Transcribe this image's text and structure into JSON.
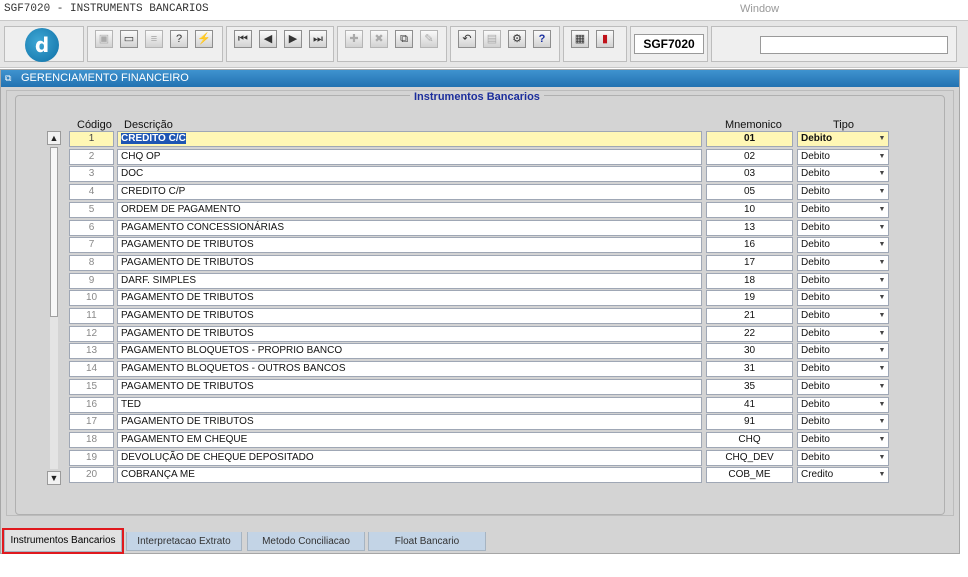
{
  "app": {
    "title": "SGF7020 - INSTRUMENTS BANCARIOS",
    "menu_window": "Window"
  },
  "toolbar": {
    "form_code": "SGF7020",
    "input_value": "",
    "icons": [
      "logo-d-icon",
      "save-icon",
      "window-icon",
      "print-icon",
      "help-query-icon",
      "execute-query-icon",
      "first-record-icon",
      "previous-record-icon",
      "next-record-icon",
      "last-record-icon",
      "insert-record-icon",
      "delete-record-icon",
      "duplicate-icon",
      "clear-icon",
      "undo-icon",
      "clipboard-icon",
      "tools-icon",
      "help-icon",
      "calculator-icon",
      "exit-icon"
    ]
  },
  "window": {
    "title": "GERENCIAMENTO FINANCEIRO",
    "section_title": "Instrumentos Bancarios"
  },
  "table": {
    "headers": {
      "code": "Código",
      "description": "Descrição",
      "mnemonic": "Mnemonico",
      "type": "Tipo"
    },
    "rows": [
      {
        "code": "1",
        "description": "CREDITO C/C",
        "mnemonic": "01",
        "type": "Debito"
      },
      {
        "code": "2",
        "description": "CHQ OP",
        "mnemonic": "02",
        "type": "Debito"
      },
      {
        "code": "3",
        "description": "DOC",
        "mnemonic": "03",
        "type": "Debito"
      },
      {
        "code": "4",
        "description": "CREDITO C/P",
        "mnemonic": "05",
        "type": "Debito"
      },
      {
        "code": "5",
        "description": "ORDEM DE PAGAMENTO",
        "mnemonic": "10",
        "type": "Debito"
      },
      {
        "code": "6",
        "description": "PAGAMENTO CONCESSIONÁRIAS",
        "mnemonic": "13",
        "type": "Debito"
      },
      {
        "code": "7",
        "description": "PAGAMENTO DE TRIBUTOS",
        "mnemonic": "16",
        "type": "Debito"
      },
      {
        "code": "8",
        "description": "PAGAMENTO DE TRIBUTOS",
        "mnemonic": "17",
        "type": "Debito"
      },
      {
        "code": "9",
        "description": "DARF. SIMPLES",
        "mnemonic": "18",
        "type": "Debito"
      },
      {
        "code": "10",
        "description": "PAGAMENTO DE TRIBUTOS",
        "mnemonic": "19",
        "type": "Debito"
      },
      {
        "code": "11",
        "description": "PAGAMENTO DE TRIBUTOS",
        "mnemonic": "21",
        "type": "Debito"
      },
      {
        "code": "12",
        "description": "PAGAMENTO DE TRIBUTOS",
        "mnemonic": "22",
        "type": "Debito"
      },
      {
        "code": "13",
        "description": "PAGAMENTO BLOQUETOS - PROPRIO BANCO",
        "mnemonic": "30",
        "type": "Debito"
      },
      {
        "code": "14",
        "description": "PAGAMENTO BLOQUETOS - OUTROS BANCOS",
        "mnemonic": "31",
        "type": "Debito"
      },
      {
        "code": "15",
        "description": "PAGAMENTO DE TRIBUTOS",
        "mnemonic": "35",
        "type": "Debito"
      },
      {
        "code": "16",
        "description": "TED",
        "mnemonic": "41",
        "type": "Debito"
      },
      {
        "code": "17",
        "description": "PAGAMENTO DE TRIBUTOS",
        "mnemonic": "91",
        "type": "Debito"
      },
      {
        "code": "18",
        "description": "PAGAMENTO EM CHEQUE",
        "mnemonic": "CHQ",
        "type": "Debito"
      },
      {
        "code": "19",
        "description": "DEVOLUÇÃO DE CHEQUE DEPOSITADO",
        "mnemonic": "CHQ_DEV",
        "type": "Debito"
      },
      {
        "code": "20",
        "description": "COBRANÇA ME",
        "mnemonic": "COB_ME",
        "type": "Credito"
      }
    ]
  },
  "tabs": [
    {
      "label": "Instrumentos Bancarios",
      "active": true
    },
    {
      "label": "Interpretacao Extrato",
      "active": false
    },
    {
      "label": "Metodo Conciliacao",
      "active": false
    },
    {
      "label": "Float Bancario",
      "active": false
    }
  ]
}
